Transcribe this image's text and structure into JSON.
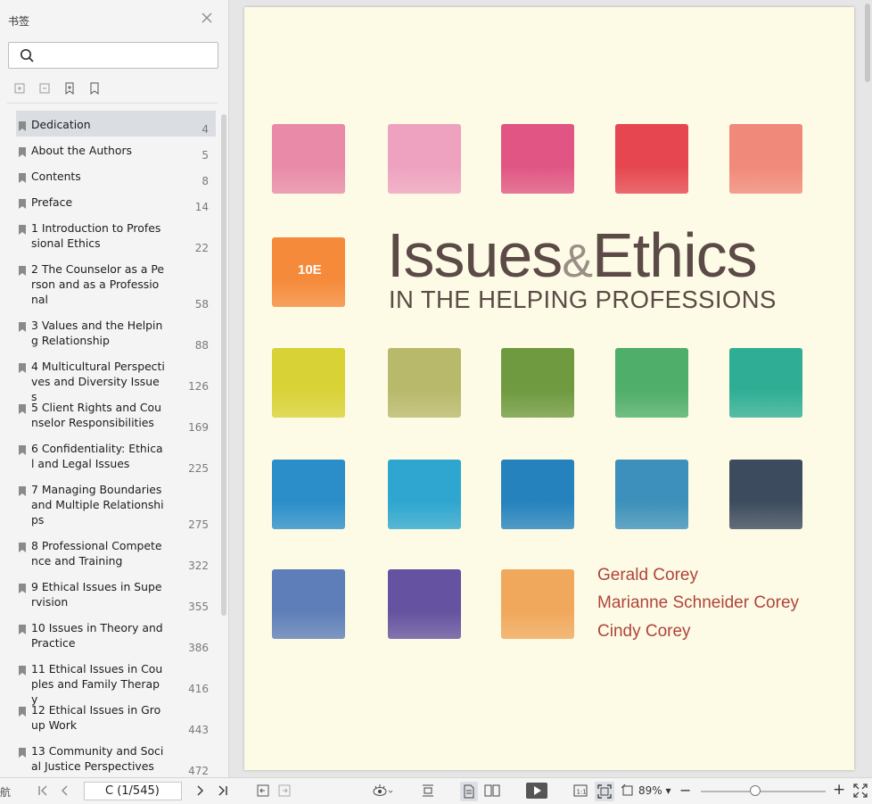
{
  "sidebar": {
    "title": "书签",
    "search_placeholder": "",
    "bookmarks": [
      {
        "label": "Dedication",
        "page": "4"
      },
      {
        "label": "About the Authors",
        "page": "5"
      },
      {
        "label": "Contents",
        "page": "8"
      },
      {
        "label": "Preface",
        "page": "14"
      },
      {
        "label": "1 Introduction to Professional Ethics",
        "page": "22"
      },
      {
        "label": "2 The Counselor as a Person and as a Professional",
        "page": "58"
      },
      {
        "label": "3 Values and the Helping Relationship",
        "page": "88"
      },
      {
        "label": "4 Multicultural Perspectives and Diversity Issues",
        "page": "126"
      },
      {
        "label": "5 Client Rights and Counselor Responsibilities",
        "page": "169"
      },
      {
        "label": "6 Confidentiality: Ethical and Legal Issues",
        "page": "225"
      },
      {
        "label": "7 Managing Boundaries and Multiple Relationships",
        "page": "275"
      },
      {
        "label": "8 Professional Competence and Training",
        "page": "322"
      },
      {
        "label": "9 Ethical Issues in Supervision",
        "page": "355"
      },
      {
        "label": "10 Issues in Theory and Practice",
        "page": "386"
      },
      {
        "label": "11 Ethical Issues in Couples and Family Therapy",
        "page": "416"
      },
      {
        "label": "12 Ethical Issues in Group Work",
        "page": "443"
      },
      {
        "label": "13 Community and Social Justice Perspectives",
        "page": "472"
      }
    ]
  },
  "cover": {
    "edition": "10E",
    "title_part1": "Issues",
    "title_amp": "&",
    "title_part2": "Ethics",
    "subtitle": "IN THE HELPING PROFESSIONS",
    "authors": [
      "Gerald Corey",
      "Marianne Schneider Corey",
      "Cindy Corey"
    ]
  },
  "swatch_colors": [
    [
      "#e88aa8",
      "#eea2c0",
      "#e05583",
      "#e5464f",
      "#f0897a"
    ],
    [
      "#f58a3a"
    ],
    [
      "#d9d237",
      "#b9b96c",
      "#6f9a40",
      "#4fae6a",
      "#2fae95"
    ],
    [
      "#2b8ec9",
      "#2ea6cf",
      "#2582bd",
      "#3d90bb",
      "#3d4b5e"
    ],
    [
      "#5d7eb8",
      "#6552a0",
      "#f0a85c"
    ]
  ],
  "toolbar": {
    "nav_label": "航",
    "page_value": "C (1/545)",
    "zoom_label": "89%"
  }
}
